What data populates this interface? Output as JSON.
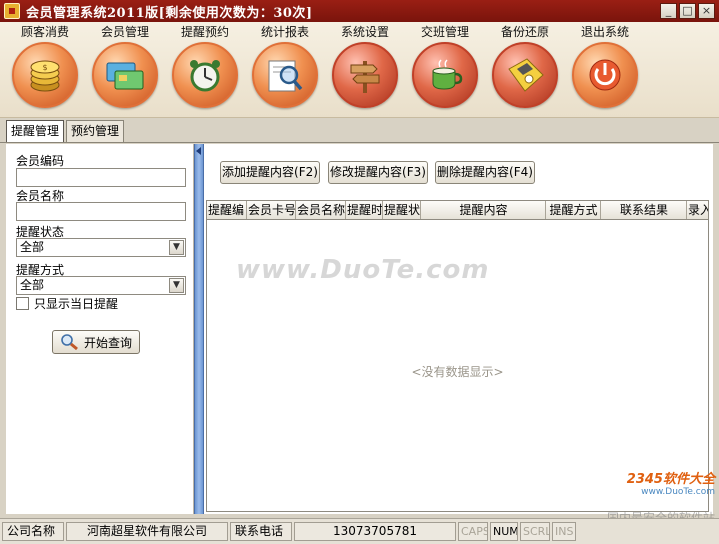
{
  "window": {
    "title": "会员管理系统2011版[剩余使用次数为：30次]",
    "buttons": [
      "_",
      "□",
      "×"
    ]
  },
  "toolbar": {
    "items": [
      {
        "label": "顾客消费",
        "icon": "coins-icon"
      },
      {
        "label": "会员管理",
        "icon": "member-cards-icon"
      },
      {
        "label": "提醒预约",
        "icon": "alarm-clock-icon"
      },
      {
        "label": "统计报表",
        "icon": "magnifier-report-icon"
      },
      {
        "label": "系统设置",
        "icon": "signpost-icon"
      },
      {
        "label": "交班管理",
        "icon": "coffee-cup-icon"
      },
      {
        "label": "备份还原",
        "icon": "floppy-disk-icon"
      },
      {
        "label": "退出系统",
        "icon": "power-icon"
      }
    ]
  },
  "tabs": [
    {
      "label": "提醒管理",
      "active": true
    },
    {
      "label": "预约管理",
      "active": false
    }
  ],
  "search": {
    "member_code_label": "会员编码",
    "member_code_value": "",
    "member_name_label": "会员名称",
    "member_name_value": "",
    "status_label": "提醒状态",
    "status_value": "全部",
    "method_label": "提醒方式",
    "method_value": "全部",
    "today_only_label": "只显示当日提醒",
    "today_only_checked": false,
    "query_button": "开始查询"
  },
  "actions": {
    "add": "添加提醒内容(F2)",
    "edit": "修改提醒内容(F3)",
    "delete": "删除提醒内容(F4)"
  },
  "grid": {
    "columns": [
      "提醒编",
      "会员卡号",
      "会员名称",
      "提醒时",
      "提醒状",
      "提醒内容",
      "提醒方式",
      "联系结果",
      "录入"
    ],
    "empty_text": "<没有数据显示>"
  },
  "watermark": {
    "main": "www.DuoTe.com",
    "logo_a": "2345",
    "logo_b": "软件大全",
    "logo_url": "www.DuoTe.com",
    "sub": "国内最安全的软件站"
  },
  "statusbar": {
    "company_label": "公司名称",
    "company_value": "河南超星软件有限公司",
    "phone_label": "联系电话",
    "phone_value": "13073705781",
    "keys": [
      "CAPS",
      "NUM",
      "SCRL",
      "INS"
    ],
    "active_key": "NUM"
  }
}
